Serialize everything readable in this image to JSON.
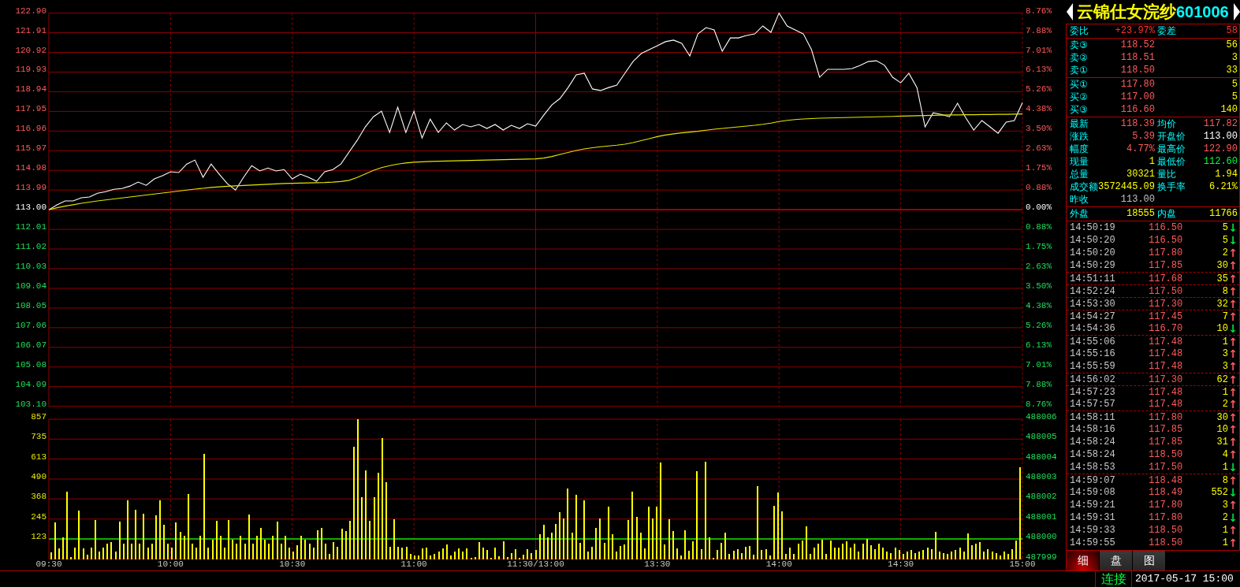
{
  "price_chart": {
    "chart_data": {
      "type": "line",
      "grid": true,
      "categories": [
        null,
        null,
        null,
        null,
        null,
        null,
        null,
        null,
        null,
        null,
        null,
        null,
        null,
        null,
        null,
        null,
        null,
        null,
        null,
        null,
        null,
        null,
        null,
        null,
        null,
        null,
        null,
        null,
        null,
        null,
        null,
        null,
        null,
        null,
        null,
        null,
        null,
        null,
        null,
        null,
        null,
        null,
        null,
        null,
        null,
        null,
        null,
        null,
        null,
        null,
        null,
        null,
        null,
        null,
        null,
        null,
        null,
        null,
        null,
        null,
        null,
        null,
        null,
        null,
        null,
        null,
        null,
        null,
        null,
        null,
        null,
        null,
        null,
        null,
        null,
        null,
        null,
        null,
        null,
        null,
        null,
        null,
        null,
        null,
        null,
        null,
        null,
        null,
        null,
        null,
        null,
        null,
        null,
        null,
        null,
        null,
        null,
        null,
        null,
        null,
        null,
        null,
        null,
        null,
        null,
        null,
        null,
        null,
        null,
        null,
        null,
        null,
        null,
        null,
        null,
        null,
        null,
        null,
        null,
        null,
        null
      ],
      "series": [
        {
          "color": "#ffffff",
          "values": [
            113.0,
            113.24,
            113.44,
            113.44,
            113.6,
            113.64,
            113.83,
            113.91,
            114.03,
            114.07,
            114.19,
            114.39,
            114.23,
            114.55,
            114.71,
            114.91,
            114.87,
            115.3,
            115.5,
            114.63,
            115.3,
            114.79,
            114.31,
            113.99,
            114.63,
            115.22,
            114.95,
            115.1,
            114.95,
            115.02,
            114.55,
            114.79,
            114.63,
            114.43,
            114.91,
            115.02,
            115.3,
            115.9,
            116.49,
            117.17,
            117.68,
            117.96,
            116.89,
            118.16,
            116.89,
            117.96,
            116.61,
            117.56,
            116.89,
            117.37,
            117.01,
            117.29,
            117.17,
            117.29,
            117.09,
            117.29,
            117.01,
            117.25,
            117.09,
            117.33,
            117.21,
            117.76,
            118.28,
            118.6,
            119.15,
            119.79,
            119.87,
            119.08,
            119.0,
            119.15,
            119.27,
            119.87,
            120.46,
            120.86,
            121.06,
            121.26,
            121.46,
            121.54,
            121.38,
            120.74,
            121.85,
            122.17,
            122.05,
            120.98,
            121.65,
            121.65,
            121.77,
            121.85,
            122.25,
            121.93,
            122.9,
            122.25,
            122.05,
            121.85,
            121.06,
            119.67,
            120.07,
            120.07,
            120.07,
            120.11,
            120.27,
            120.46,
            120.5,
            120.27,
            119.67,
            119.39,
            119.87,
            119.15,
            117.17,
            117.88,
            117.8,
            117.68,
            118.36,
            117.64,
            117.01,
            117.49,
            117.17,
            116.85,
            117.41,
            117.49,
            118.39
          ]
        },
        {
          "color": "#e6e600",
          "values": [
            113.0,
            113.1,
            113.18,
            113.25,
            113.32,
            113.38,
            113.44,
            113.49,
            113.54,
            113.59,
            113.64,
            113.69,
            113.74,
            113.79,
            113.84,
            113.89,
            113.94,
            113.99,
            114.04,
            114.08,
            114.12,
            114.15,
            114.18,
            114.2,
            114.22,
            114.24,
            114.26,
            114.28,
            114.3,
            114.32,
            114.33,
            114.34,
            114.35,
            114.36,
            114.37,
            114.39,
            114.42,
            114.48,
            114.62,
            114.8,
            114.98,
            115.12,
            115.22,
            115.3,
            115.35,
            115.39,
            115.41,
            115.43,
            115.44,
            115.45,
            115.46,
            115.47,
            115.48,
            115.49,
            115.5,
            115.51,
            115.52,
            115.53,
            115.54,
            115.55,
            115.56,
            115.6,
            115.68,
            115.78,
            115.88,
            115.98,
            116.06,
            116.12,
            116.17,
            116.21,
            116.25,
            116.3,
            116.38,
            116.48,
            116.58,
            116.68,
            116.76,
            116.82,
            116.87,
            116.91,
            116.95,
            117.0,
            117.05,
            117.09,
            117.13,
            117.17,
            117.21,
            117.25,
            117.3,
            117.36,
            117.44,
            117.5,
            117.54,
            117.57,
            117.59,
            117.61,
            117.62,
            117.63,
            117.64,
            117.65,
            117.66,
            117.67,
            117.68,
            117.69,
            117.7,
            117.71,
            117.72,
            117.73,
            117.74,
            117.75,
            117.76,
            117.77,
            117.77,
            117.78,
            117.78,
            117.79,
            117.79,
            117.8,
            117.8,
            117.81,
            117.82
          ]
        }
      ],
      "ylim": [
        103.1,
        122.9
      ],
      "yticks": [
        {
          "value": 122.9,
          "label": "122.90"
        },
        {
          "value": 121.91,
          "label": "121.91"
        },
        {
          "value": 120.92,
          "label": "120.92"
        },
        {
          "value": 119.93,
          "label": "119.93"
        },
        {
          "value": 118.94,
          "label": "118.94"
        },
        {
          "value": 117.95,
          "label": "117.95"
        },
        {
          "value": 116.96,
          "label": "116.96"
        },
        {
          "value": 115.97,
          "label": "115.97"
        },
        {
          "value": 114.98,
          "label": "114.98"
        },
        {
          "value": 113.99,
          "label": "113.99"
        },
        {
          "value": 113.0,
          "label": "113.00"
        },
        {
          "value": 112.01,
          "label": "112.01"
        },
        {
          "value": 111.02,
          "label": "111.02"
        },
        {
          "value": 110.03,
          "label": "110.03"
        },
        {
          "value": 109.04,
          "label": "109.04"
        },
        {
          "value": 108.05,
          "label": "108.05"
        },
        {
          "value": 107.06,
          "label": "107.06"
        },
        {
          "value": 106.07,
          "label": "106.07"
        },
        {
          "value": 105.08,
          "label": "105.08"
        },
        {
          "value": 104.09,
          "label": "104.09"
        },
        {
          "value": 103.1,
          "label": "103.10"
        }
      ],
      "ref_lines": [
        {
          "axis": "y",
          "value": 113.0
        }
      ]
    },
    "percent_labels": [
      {
        "text": "8.76%",
        "kind": "up"
      },
      {
        "text": "7.88%",
        "kind": "up"
      },
      {
        "text": "7.01%",
        "kind": "up"
      },
      {
        "text": "6.13%",
        "kind": "up"
      },
      {
        "text": "5.26%",
        "kind": "up"
      },
      {
        "text": "4.38%",
        "kind": "up"
      },
      {
        "text": "3.50%",
        "kind": "up"
      },
      {
        "text": "2.63%",
        "kind": "up"
      },
      {
        "text": "1.75%",
        "kind": "up"
      },
      {
        "text": "0.88%",
        "kind": "up"
      },
      {
        "text": "0.00%",
        "kind": "flat"
      },
      {
        "text": "0.88%",
        "kind": "down"
      },
      {
        "text": "1.75%",
        "kind": "down"
      },
      {
        "text": "2.63%",
        "kind": "down"
      },
      {
        "text": "3.50%",
        "kind": "down"
      },
      {
        "text": "4.38%",
        "kind": "down"
      },
      {
        "text": "5.26%",
        "kind": "down"
      },
      {
        "text": "6.13%",
        "kind": "down"
      },
      {
        "text": "7.01%",
        "kind": "down"
      },
      {
        "text": "7.88%",
        "kind": "down"
      },
      {
        "text": "8.76%",
        "kind": "down"
      }
    ]
  },
  "volume_chart": {
    "chart_data": {
      "type": "bar",
      "grid": true,
      "categories": [
        "09:30",
        null,
        null,
        null,
        null,
        null,
        null,
        null,
        null,
        null,
        null,
        null,
        null,
        null,
        null,
        null,
        null,
        null,
        null,
        null,
        null,
        null,
        null,
        null,
        null,
        null,
        null,
        null,
        null,
        null,
        "10:00",
        null,
        null,
        null,
        null,
        null,
        null,
        null,
        null,
        null,
        null,
        null,
        null,
        null,
        null,
        null,
        null,
        null,
        null,
        null,
        null,
        null,
        null,
        null,
        null,
        null,
        null,
        null,
        null,
        null,
        "10:30",
        null,
        null,
        null,
        null,
        null,
        null,
        null,
        null,
        null,
        null,
        null,
        null,
        null,
        null,
        null,
        null,
        null,
        null,
        null,
        null,
        null,
        null,
        null,
        null,
        null,
        null,
        null,
        null,
        null,
        "11:00",
        null,
        null,
        null,
        null,
        null,
        null,
        null,
        null,
        null,
        null,
        null,
        null,
        null,
        null,
        null,
        null,
        null,
        null,
        null,
        null,
        null,
        null,
        null,
        null,
        null,
        null,
        null,
        null,
        null,
        "11:30/13:00",
        null,
        null,
        null,
        null,
        null,
        null,
        null,
        null,
        null,
        null,
        null,
        null,
        null,
        null,
        null,
        null,
        null,
        null,
        null,
        null,
        null,
        null,
        null,
        null,
        null,
        null,
        null,
        null,
        null,
        "13:30",
        null,
        null,
        null,
        null,
        null,
        null,
        null,
        null,
        null,
        null,
        null,
        null,
        null,
        null,
        null,
        null,
        null,
        null,
        null,
        null,
        null,
        null,
        null,
        null,
        null,
        null,
        null,
        null,
        null,
        "14:00",
        null,
        null,
        null,
        null,
        null,
        null,
        null,
        null,
        null,
        null,
        null,
        null,
        null,
        null,
        null,
        null,
        null,
        null,
        null,
        null,
        null,
        null,
        null,
        null,
        null,
        null,
        null,
        null,
        null,
        "14:30",
        null,
        null,
        null,
        null,
        null,
        null,
        null,
        null,
        null,
        null,
        null,
        null,
        null,
        null,
        null,
        null,
        null,
        null,
        null,
        null,
        null,
        null,
        null,
        null,
        null,
        null,
        null,
        null,
        null,
        "15:00"
      ],
      "series": [
        {
          "color": "#ffff00",
          "values": [
            41,
            225,
            65,
            132,
            413,
            10,
            70,
            299,
            65,
            27,
            70,
            241,
            46,
            70,
            94,
            104,
            46,
            230,
            94,
            360,
            94,
            300,
            94,
            280,
            70,
            94,
            270,
            360,
            210,
            94,
            70,
            225,
            167,
            142,
            400,
            94,
            70,
            142,
            645,
            70,
            118,
            235,
            142,
            70,
            240,
            118,
            94,
            142,
            94,
            275,
            94,
            142,
            191,
            118,
            94,
            142,
            230,
            94,
            142,
            70,
            46,
            85,
            142,
            118,
            94,
            70,
            178,
            193,
            96,
            33,
            105,
            77,
            187,
            172,
            232,
            688,
            857,
            377,
            542,
            232,
            377,
            527,
            739,
            473,
            77,
            246,
            77,
            68,
            77,
            30,
            20,
            24,
            66,
            70,
            24,
            33,
            44,
            66,
            87,
            24,
            44,
            66,
            44,
            66,
            5,
            10,
            105,
            70,
            57,
            5,
            70,
            15,
            111,
            10,
            38,
            62,
            5,
            28,
            62,
            38,
            57,
            150,
            208,
            135,
            163,
            217,
            289,
            250,
            430,
            163,
            395,
            101,
            358,
            44,
            77,
            189,
            250,
            101,
            319,
            150,
            44,
            82,
            91,
            237,
            412,
            256,
            162,
            66,
            319,
            250,
            319,
            590,
            87,
            246,
            170,
            66,
            24,
            175,
            53,
            110,
            536,
            62,
            594,
            135,
            5,
            57,
            101,
            163,
            33,
            49,
            62,
            38,
            77,
            82,
            28,
            449,
            57,
            62,
            24,
            325,
            406,
            290,
            33,
            70,
            30,
            94,
            113,
            200,
            30,
            70,
            94,
            118,
            30,
            113,
            70,
            70,
            94,
            109,
            70,
            94,
            46,
            94,
            123,
            85,
            60,
            94,
            70,
            46,
            35,
            70,
            55,
            30,
            46,
            55,
            35,
            46,
            55,
            70,
            60,
            167,
            46,
            35,
            30,
            46,
            55,
            70,
            46,
            157,
            85,
            94,
            104,
            46,
            60,
            46,
            35,
            22,
            46,
            30,
            60,
            113,
            563
          ]
        }
      ],
      "ylim": [
        0,
        857
      ],
      "yticks": [
        857,
        735,
        613,
        490,
        368,
        245,
        123
      ],
      "ref_lines": [
        {
          "axis": "y",
          "value": 123
        }
      ]
    },
    "right_labels": [
      "488006",
      "488005",
      "488004",
      "488003",
      "488002",
      "488001",
      "488000",
      "487999"
    ]
  },
  "quote_panel": {
    "name": "云锦仕女浣纱",
    "code": "601006",
    "order_summary": [
      {
        "label": "委比",
        "value": "+23.97%",
        "color": "#ff3030"
      },
      {
        "label": "委差",
        "value": "58",
        "color": "#ff3030"
      }
    ],
    "asks": [
      {
        "label": "卖③",
        "price": "118.52",
        "volume": "56"
      },
      {
        "label": "卖②",
        "price": "118.51",
        "volume": "3"
      },
      {
        "label": "卖①",
        "price": "118.50",
        "volume": "33"
      }
    ],
    "bids": [
      {
        "label": "买①",
        "price": "117.80",
        "volume": "5"
      },
      {
        "label": "买②",
        "price": "117.00",
        "volume": "5"
      },
      {
        "label": "买③",
        "price": "116.60",
        "volume": "140"
      }
    ],
    "stats": [
      {
        "label": "最新",
        "value": "118.39",
        "color": "#ff5a5a"
      },
      {
        "label": "均价",
        "value": "117.82",
        "color": "#ff5a5a"
      },
      {
        "label": "涨跌",
        "value": "5.39",
        "color": "#ff5a5a"
      },
      {
        "label": "开盘价",
        "value": "113.00",
        "color": "#ffffff"
      },
      {
        "label": "幅度",
        "value": "4.77%",
        "color": "#ff5a5a"
      },
      {
        "label": "最高价",
        "value": "122.90",
        "color": "#ff5a5a"
      },
      {
        "label": "现量",
        "value": "1",
        "color": "#ffff00"
      },
      {
        "label": "最低价",
        "value": "112.60",
        "color": "#00ff40"
      },
      {
        "label": "总量",
        "value": "30321",
        "color": "#ffff00"
      },
      {
        "label": "量比",
        "value": "1.94",
        "color": "#ffff00"
      },
      {
        "label": "成交额",
        "value": "3572445.09",
        "color": "#ffff00"
      },
      {
        "label": "换手率",
        "value": "6.21%",
        "color": "#ffff00"
      },
      {
        "label": "昨收",
        "value": "113.00",
        "color": "#c0c0c0"
      }
    ],
    "trade_balance": [
      {
        "label": "外盘",
        "value": "18555",
        "color": "#ffff00"
      },
      {
        "label": "内盘",
        "value": "11766",
        "color": "#ffff00"
      }
    ]
  },
  "trades": [
    {
      "time": "14:50:19",
      "price": "116.50",
      "volume": "5",
      "arrow": "↓",
      "color": "#00e040",
      "divider_above": false
    },
    {
      "time": "14:50:20",
      "price": "116.50",
      "volume": "5",
      "arrow": "↓",
      "color": "#00e040",
      "divider_above": false
    },
    {
      "time": "14:50:20",
      "price": "117.80",
      "volume": "2",
      "arrow": "↑",
      "color": "#ff5a5a",
      "divider_above": false
    },
    {
      "time": "14:50:29",
      "price": "117.85",
      "volume": "30",
      "arrow": "↑",
      "color": "#ff5a5a",
      "divider_above": false
    },
    {
      "time": "14:51:11",
      "price": "117.68",
      "volume": "35",
      "arrow": "↑",
      "color": "#ff5a5a",
      "divider_above": true
    },
    {
      "time": "14:52:24",
      "price": "117.50",
      "volume": "8",
      "arrow": "↑",
      "color": "#ff5a5a",
      "divider_above": true
    },
    {
      "time": "14:53:30",
      "price": "117.30",
      "volume": "32",
      "arrow": "↑",
      "color": "#ff5a5a",
      "divider_above": true
    },
    {
      "time": "14:54:27",
      "price": "117.45",
      "volume": "7",
      "arrow": "↑",
      "color": "#ff5a5a",
      "divider_above": true
    },
    {
      "time": "14:54:36",
      "price": "116.70",
      "volume": "10",
      "arrow": "↓",
      "color": "#00e040",
      "divider_above": false
    },
    {
      "time": "14:55:06",
      "price": "117.48",
      "volume": "1",
      "arrow": "↑",
      "color": "#ff5a5a",
      "divider_above": true
    },
    {
      "time": "14:55:16",
      "price": "117.48",
      "volume": "3",
      "arrow": "↑",
      "color": "#ff5a5a",
      "divider_above": false
    },
    {
      "time": "14:55:59",
      "price": "117.48",
      "volume": "3",
      "arrow": "↑",
      "color": "#ff5a5a",
      "divider_above": false
    },
    {
      "time": "14:56:02",
      "price": "117.30",
      "volume": "62",
      "arrow": "↑",
      "color": "#ff5a5a",
      "divider_above": true
    },
    {
      "time": "14:57:23",
      "price": "117.48",
      "volume": "1",
      "arrow": "↑",
      "color": "#ff5a5a",
      "divider_above": true
    },
    {
      "time": "14:57:57",
      "price": "117.48",
      "volume": "2",
      "arrow": "↑",
      "color": "#ff5a5a",
      "divider_above": false
    },
    {
      "time": "14:58:11",
      "price": "117.80",
      "volume": "30",
      "arrow": "↑",
      "color": "#ff5a5a",
      "divider_above": true
    },
    {
      "time": "14:58:16",
      "price": "117.85",
      "volume": "10",
      "arrow": "↑",
      "color": "#ff5a5a",
      "divider_above": false
    },
    {
      "time": "14:58:24",
      "price": "117.85",
      "volume": "31",
      "arrow": "↑",
      "color": "#ff5a5a",
      "divider_above": false
    },
    {
      "time": "14:58:24",
      "price": "118.50",
      "volume": "4",
      "arrow": "↑",
      "color": "#ff5a5a",
      "divider_above": false
    },
    {
      "time": "14:58:53",
      "price": "117.50",
      "volume": "1",
      "arrow": "↓",
      "color": "#00e040",
      "divider_above": false
    },
    {
      "time": "14:59:07",
      "price": "118.48",
      "volume": "8",
      "arrow": "↑",
      "color": "#ff5a5a",
      "divider_above": true
    },
    {
      "time": "14:59:08",
      "price": "118.49",
      "volume": "552",
      "arrow": "↓",
      "color": "#00e040",
      "divider_above": false
    },
    {
      "time": "14:59:21",
      "price": "117.80",
      "volume": "3",
      "arrow": "↑",
      "color": "#ff5a5a",
      "divider_above": false
    },
    {
      "time": "14:59:31",
      "price": "117.80",
      "volume": "2",
      "arrow": "↓",
      "color": "#00e040",
      "divider_above": false
    },
    {
      "time": "14:59:33",
      "price": "118.50",
      "volume": "1",
      "arrow": "↑",
      "color": "#ff5a5a",
      "divider_above": false
    },
    {
      "time": "14:59:55",
      "price": "118.50",
      "volume": "1",
      "arrow": "↑",
      "color": "#ff5a5a",
      "divider_above": false
    }
  ],
  "tabs": [
    {
      "label": "细",
      "selected": true
    },
    {
      "label": "盘",
      "selected": false
    },
    {
      "label": "图",
      "selected": false
    }
  ],
  "status_bar": {
    "connection": "连接",
    "datetime": "2017-05-17 15:00"
  }
}
